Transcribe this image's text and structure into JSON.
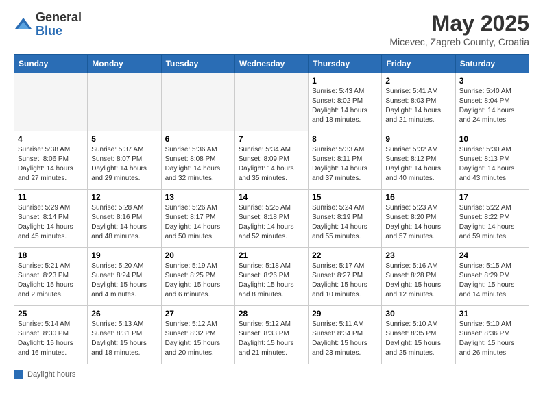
{
  "header": {
    "logo_general": "General",
    "logo_blue": "Blue",
    "month_title": "May 2025",
    "location": "Micevec, Zagreb County, Croatia"
  },
  "calendar": {
    "days_of_week": [
      "Sunday",
      "Monday",
      "Tuesday",
      "Wednesday",
      "Thursday",
      "Friday",
      "Saturday"
    ],
    "weeks": [
      [
        {
          "day": "",
          "info": ""
        },
        {
          "day": "",
          "info": ""
        },
        {
          "day": "",
          "info": ""
        },
        {
          "day": "",
          "info": ""
        },
        {
          "day": "1",
          "info": "Sunrise: 5:43 AM\nSunset: 8:02 PM\nDaylight: 14 hours and 18 minutes."
        },
        {
          "day": "2",
          "info": "Sunrise: 5:41 AM\nSunset: 8:03 PM\nDaylight: 14 hours and 21 minutes."
        },
        {
          "day": "3",
          "info": "Sunrise: 5:40 AM\nSunset: 8:04 PM\nDaylight: 14 hours and 24 minutes."
        }
      ],
      [
        {
          "day": "4",
          "info": "Sunrise: 5:38 AM\nSunset: 8:06 PM\nDaylight: 14 hours and 27 minutes."
        },
        {
          "day": "5",
          "info": "Sunrise: 5:37 AM\nSunset: 8:07 PM\nDaylight: 14 hours and 29 minutes."
        },
        {
          "day": "6",
          "info": "Sunrise: 5:36 AM\nSunset: 8:08 PM\nDaylight: 14 hours and 32 minutes."
        },
        {
          "day": "7",
          "info": "Sunrise: 5:34 AM\nSunset: 8:09 PM\nDaylight: 14 hours and 35 minutes."
        },
        {
          "day": "8",
          "info": "Sunrise: 5:33 AM\nSunset: 8:11 PM\nDaylight: 14 hours and 37 minutes."
        },
        {
          "day": "9",
          "info": "Sunrise: 5:32 AM\nSunset: 8:12 PM\nDaylight: 14 hours and 40 minutes."
        },
        {
          "day": "10",
          "info": "Sunrise: 5:30 AM\nSunset: 8:13 PM\nDaylight: 14 hours and 43 minutes."
        }
      ],
      [
        {
          "day": "11",
          "info": "Sunrise: 5:29 AM\nSunset: 8:14 PM\nDaylight: 14 hours and 45 minutes."
        },
        {
          "day": "12",
          "info": "Sunrise: 5:28 AM\nSunset: 8:16 PM\nDaylight: 14 hours and 48 minutes."
        },
        {
          "day": "13",
          "info": "Sunrise: 5:26 AM\nSunset: 8:17 PM\nDaylight: 14 hours and 50 minutes."
        },
        {
          "day": "14",
          "info": "Sunrise: 5:25 AM\nSunset: 8:18 PM\nDaylight: 14 hours and 52 minutes."
        },
        {
          "day": "15",
          "info": "Sunrise: 5:24 AM\nSunset: 8:19 PM\nDaylight: 14 hours and 55 minutes."
        },
        {
          "day": "16",
          "info": "Sunrise: 5:23 AM\nSunset: 8:20 PM\nDaylight: 14 hours and 57 minutes."
        },
        {
          "day": "17",
          "info": "Sunrise: 5:22 AM\nSunset: 8:22 PM\nDaylight: 14 hours and 59 minutes."
        }
      ],
      [
        {
          "day": "18",
          "info": "Sunrise: 5:21 AM\nSunset: 8:23 PM\nDaylight: 15 hours and 2 minutes."
        },
        {
          "day": "19",
          "info": "Sunrise: 5:20 AM\nSunset: 8:24 PM\nDaylight: 15 hours and 4 minutes."
        },
        {
          "day": "20",
          "info": "Sunrise: 5:19 AM\nSunset: 8:25 PM\nDaylight: 15 hours and 6 minutes."
        },
        {
          "day": "21",
          "info": "Sunrise: 5:18 AM\nSunset: 8:26 PM\nDaylight: 15 hours and 8 minutes."
        },
        {
          "day": "22",
          "info": "Sunrise: 5:17 AM\nSunset: 8:27 PM\nDaylight: 15 hours and 10 minutes."
        },
        {
          "day": "23",
          "info": "Sunrise: 5:16 AM\nSunset: 8:28 PM\nDaylight: 15 hours and 12 minutes."
        },
        {
          "day": "24",
          "info": "Sunrise: 5:15 AM\nSunset: 8:29 PM\nDaylight: 15 hours and 14 minutes."
        }
      ],
      [
        {
          "day": "25",
          "info": "Sunrise: 5:14 AM\nSunset: 8:30 PM\nDaylight: 15 hours and 16 minutes."
        },
        {
          "day": "26",
          "info": "Sunrise: 5:13 AM\nSunset: 8:31 PM\nDaylight: 15 hours and 18 minutes."
        },
        {
          "day": "27",
          "info": "Sunrise: 5:12 AM\nSunset: 8:32 PM\nDaylight: 15 hours and 20 minutes."
        },
        {
          "day": "28",
          "info": "Sunrise: 5:12 AM\nSunset: 8:33 PM\nDaylight: 15 hours and 21 minutes."
        },
        {
          "day": "29",
          "info": "Sunrise: 5:11 AM\nSunset: 8:34 PM\nDaylight: 15 hours and 23 minutes."
        },
        {
          "day": "30",
          "info": "Sunrise: 5:10 AM\nSunset: 8:35 PM\nDaylight: 15 hours and 25 minutes."
        },
        {
          "day": "31",
          "info": "Sunrise: 5:10 AM\nSunset: 8:36 PM\nDaylight: 15 hours and 26 minutes."
        }
      ]
    ]
  },
  "legend": {
    "text": "Daylight hours"
  }
}
